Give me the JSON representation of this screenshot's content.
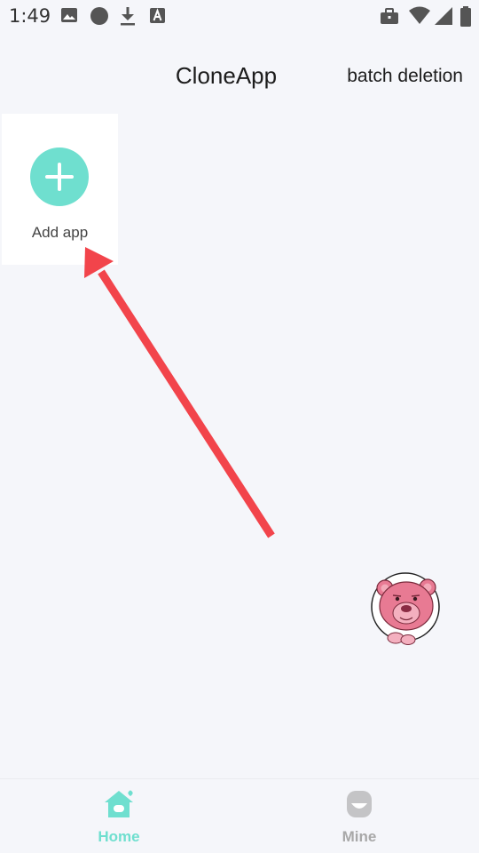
{
  "status_bar": {
    "time": "1:49",
    "icons": [
      "image-icon",
      "circle-icon",
      "download-icon",
      "a-icon",
      "briefcase-icon",
      "wifi-icon",
      "signal-icon",
      "battery-icon"
    ]
  },
  "header": {
    "title": "CloneApp",
    "batch_delete_label": "batch deletion"
  },
  "add_app": {
    "label": "Add app",
    "icon": "plus-icon",
    "accent_color": "#6fdfcf"
  },
  "overlay": {
    "arrow_color": "#f2444b"
  },
  "floating_button": {
    "icon": "pink-bear-avatar-icon"
  },
  "bottom_nav": {
    "items": [
      {
        "label": "Home",
        "icon": "home-icon",
        "active": true
      },
      {
        "label": "Mine",
        "icon": "mine-icon",
        "active": false
      }
    ],
    "active_color": "#6fdfcf",
    "inactive_color": "#a8a8a8"
  }
}
